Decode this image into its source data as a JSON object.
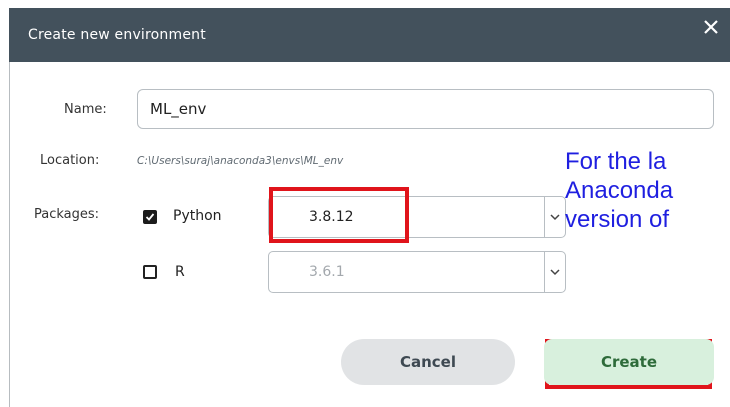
{
  "dialog": {
    "title": "Create new environment",
    "close_icon": "close-icon"
  },
  "form": {
    "name_label": "Name:",
    "name_value": "ML_env",
    "location_label": "Location:",
    "location_value": "C:\\Users\\suraj\\anaconda3\\envs\\ML_env",
    "packages_label": "Packages:",
    "packages": [
      {
        "name": "Python",
        "checked": true,
        "version": "3.8.12",
        "enabled": true
      },
      {
        "name": "R",
        "checked": false,
        "version": "3.6.1",
        "enabled": false
      }
    ]
  },
  "buttons": {
    "cancel": "Cancel",
    "create": "Create"
  },
  "overlay_annotation": {
    "lines": [
      "For the la",
      "Anaconda",
      "version of"
    ],
    "color": "#1f1fe0"
  },
  "colors": {
    "titlebar": "#43515c",
    "highlight": "#e0141b",
    "create_bg": "#d8f0dd",
    "cancel_bg": "#e1e3e5"
  }
}
